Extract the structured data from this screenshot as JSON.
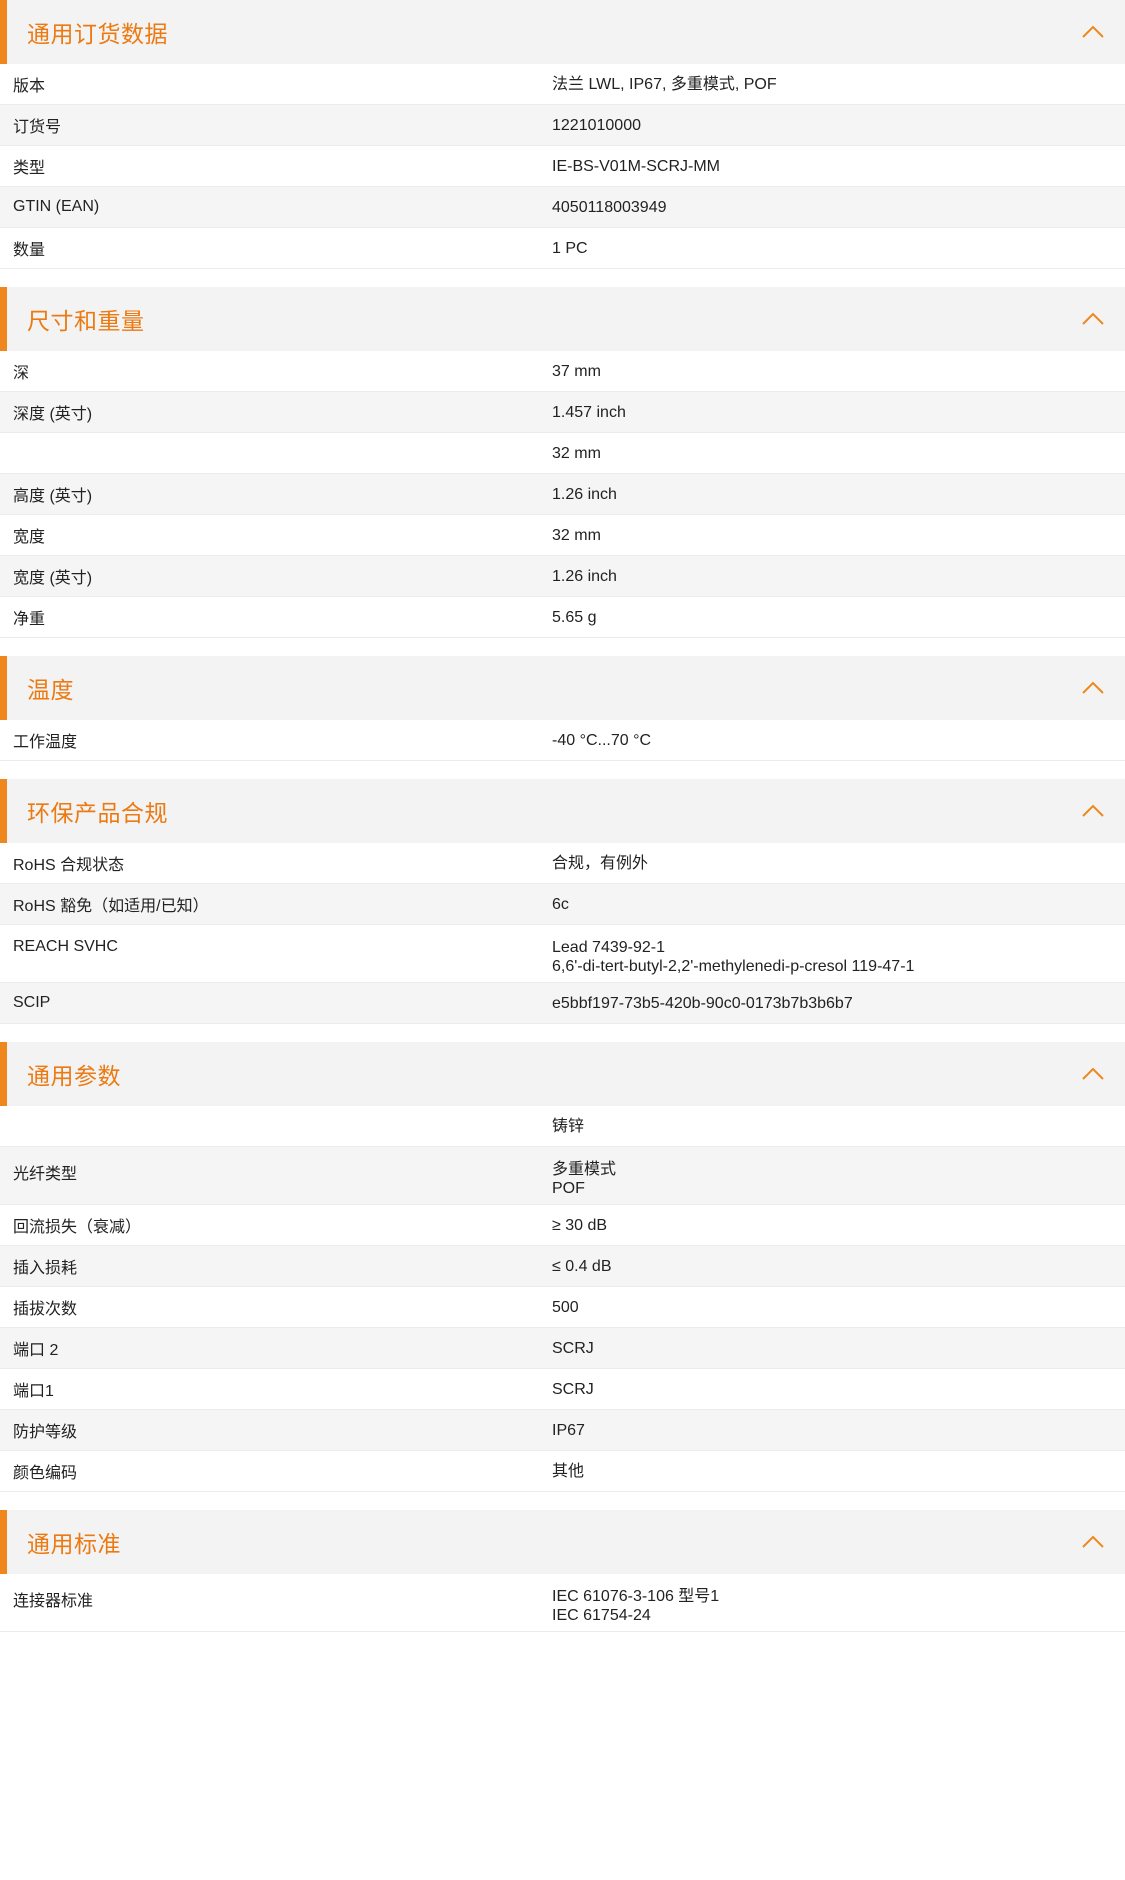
{
  "sections": [
    {
      "title": "通用订货数据",
      "rows": [
        {
          "label": "版本",
          "values": [
            "法兰 LWL, IP67, 多重模式, POF"
          ]
        },
        {
          "label": "订货号",
          "values": [
            "1221010000"
          ]
        },
        {
          "label": "类型",
          "values": [
            "IE-BS-V01M-SCRJ-MM"
          ]
        },
        {
          "label": "GTIN (EAN)",
          "values": [
            "4050118003949"
          ]
        },
        {
          "label": "数量",
          "values": [
            "1  PC"
          ]
        }
      ]
    },
    {
      "title": "尺寸和重量",
      "rows": [
        {
          "label": "深",
          "values": [
            "37  mm"
          ]
        },
        {
          "label": "深度 (英寸)",
          "values": [
            "1.457  inch"
          ]
        },
        {
          "label": "",
          "values": [
            "32  mm"
          ]
        },
        {
          "label": "高度 (英寸)",
          "values": [
            "1.26  inch"
          ]
        },
        {
          "label": "宽度",
          "values": [
            "32  mm"
          ]
        },
        {
          "label": "宽度 (英寸)",
          "values": [
            "1.26  inch"
          ]
        },
        {
          "label": "净重",
          "values": [
            "5.65  g"
          ]
        }
      ]
    },
    {
      "title": "温度",
      "rows": [
        {
          "label": "工作温度",
          "values": [
            "-40 °C...70 °C"
          ]
        }
      ]
    },
    {
      "title": "环保产品合规",
      "rows": [
        {
          "label": "RoHS 合规状态",
          "values": [
            "合规，有例外"
          ]
        },
        {
          "label": "RoHS 豁免（如适用/已知）",
          "values": [
            "6c"
          ]
        },
        {
          "label": "REACH SVHC",
          "values": [
            "Lead 7439-92-1",
            "6,6'-di-tert-butyl-2,2'-methylenedi-p-cresol 119-47-1"
          ]
        },
        {
          "label": "SCIP",
          "values": [
            "e5bbf197-73b5-420b-90c0-0173b7b3b6b7"
          ]
        }
      ]
    },
    {
      "title": "通用参数",
      "rows": [
        {
          "label": "",
          "values": [
            "铸锌"
          ]
        },
        {
          "label": "光纤类型",
          "values": [
            "多重模式",
            "POF"
          ]
        },
        {
          "label": "回流损失（衰减）",
          "values": [
            "≥ 30 dB"
          ]
        },
        {
          "label": "插入损耗",
          "values": [
            "≤ 0.4 dB"
          ]
        },
        {
          "label": "插拔次数",
          "values": [
            "500"
          ]
        },
        {
          "label": "端口 2",
          "values": [
            "SCRJ"
          ]
        },
        {
          "label": "端口1",
          "values": [
            "SCRJ"
          ]
        },
        {
          "label": "防护等级",
          "values": [
            "IP67"
          ]
        },
        {
          "label": "颜色编码",
          "values": [
            "其他"
          ]
        }
      ]
    },
    {
      "title": "通用标准",
      "rows": [
        {
          "label": "连接器标准",
          "values": [
            "IEC 61076-3-106 型号1",
            "IEC 61754-24"
          ]
        }
      ]
    }
  ],
  "icons": {
    "collapse": "chevron-up-icon"
  },
  "colors": {
    "accent": "#f0871e",
    "title": "#ec7a12",
    "header_bg": "#f3f3f3",
    "row_alt_bg": "#f5f5f5"
  }
}
